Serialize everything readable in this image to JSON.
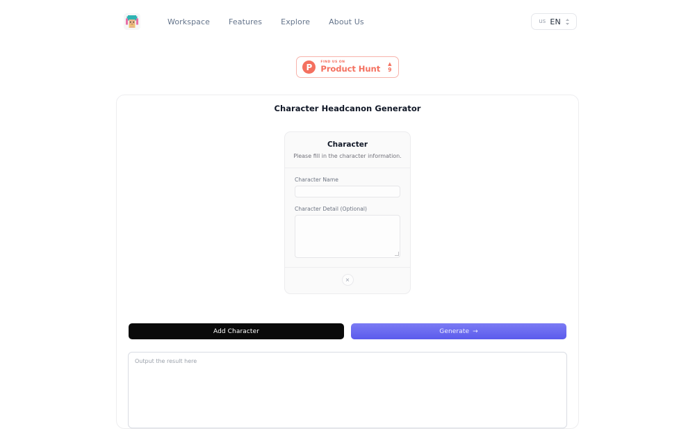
{
  "nav": {
    "logo_icon": "pixel-avatar-logo",
    "links": [
      {
        "label": "Workspace"
      },
      {
        "label": "Features"
      },
      {
        "label": "Explore"
      },
      {
        "label": "About Us"
      }
    ],
    "language": {
      "region": "us",
      "code": "EN",
      "chevron_icon": "chevron-up-down-icon"
    }
  },
  "product_hunt": {
    "mark_letter": "P",
    "kicker": "FIND US ON",
    "name": "Product Hunt",
    "caret": "▲",
    "count": "9"
  },
  "main": {
    "title": "Character Headcanon Generator",
    "character_card": {
      "title": "Character",
      "description": "Please fill in the character information.",
      "fields": [
        {
          "label": "Character Name",
          "value": "",
          "placeholder": ""
        },
        {
          "label": "Character Detail (Optional)",
          "value": "",
          "placeholder": ""
        }
      ],
      "remove_label": "×"
    },
    "actions": {
      "add_character_label": "Add Character",
      "generate_label": "Generate",
      "generate_arrow": "→"
    },
    "output": {
      "value": "",
      "placeholder": "Output the result here"
    }
  },
  "colors": {
    "primary": "#6366f1",
    "dark": "#0a0a0a",
    "product_hunt": "#f4705f",
    "muted_text": "#64748b"
  }
}
